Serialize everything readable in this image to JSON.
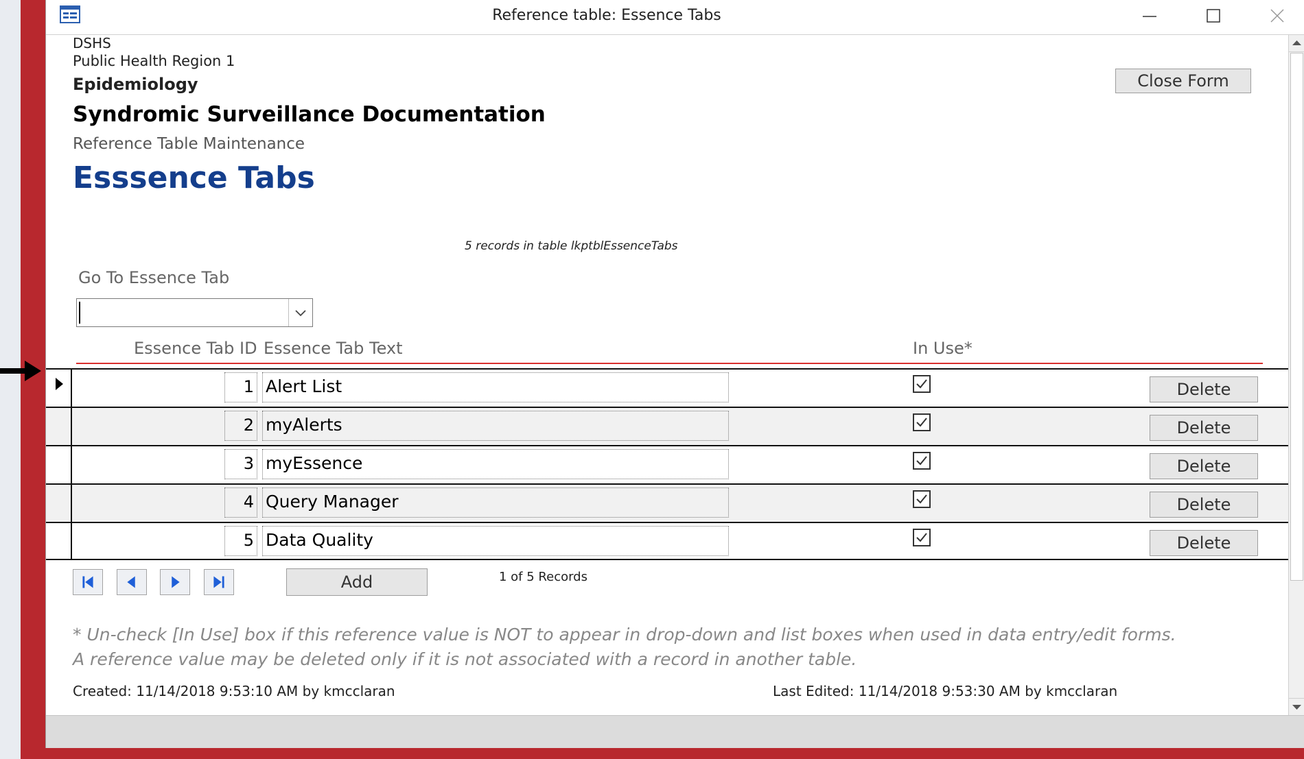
{
  "window": {
    "title": "Reference table: Essence Tabs",
    "icons": {
      "app": "form-icon",
      "minimize": "minimize-icon",
      "maximize": "maximize-icon",
      "close": "close-icon"
    }
  },
  "header": {
    "org_line1": "DSHS",
    "org_line2": "Public Health Region 1",
    "department": "Epidemiology",
    "doc_title": "Syndromic Surveillance Documentation",
    "section": "Reference Table Maintenance",
    "form_title": "Esssence Tabs",
    "close_form_label": "Close Form"
  },
  "record_info": "5 records in table lkptblEssenceTabs",
  "goto": {
    "label": "Go To Essence Tab",
    "value": ""
  },
  "columns": {
    "id": "Essence Tab ID",
    "text": "Essence Tab Text",
    "in_use": "In Use*"
  },
  "rows": [
    {
      "id": "1",
      "text": "Alert List",
      "in_use": true,
      "delete_label": "Delete"
    },
    {
      "id": "2",
      "text": "myAlerts",
      "in_use": true,
      "delete_label": "Delete"
    },
    {
      "id": "3",
      "text": "myEssence",
      "in_use": true,
      "delete_label": "Delete"
    },
    {
      "id": "4",
      "text": "Query Manager",
      "in_use": true,
      "delete_label": "Delete"
    },
    {
      "id": "5",
      "text": "Data Quality",
      "in_use": true,
      "delete_label": "Delete"
    }
  ],
  "nav": {
    "icons": [
      "first-record-icon",
      "previous-record-icon",
      "next-record-icon",
      "last-record-icon"
    ],
    "add_label": "Add",
    "record_counter": "1 of 5 Records"
  },
  "footer": {
    "note1": "* Un-check [In Use] box if this reference value is NOT to appear in drop-down and list boxes when used in data entry/edit forms.",
    "note2": "A reference value may be deleted only if it is not associated with a record in another table.",
    "created": "Created: 11/14/2018 9:53:10 AM by kmcclaran",
    "last_edited": "Last Edited: 11/14/2018 9:53:30 AM by kmcclaran"
  },
  "colors": {
    "accent_title": "#143e8c",
    "frame": "#b8282e",
    "header_rule": "#d9302e",
    "nav_blue": "#1f5fd8"
  }
}
